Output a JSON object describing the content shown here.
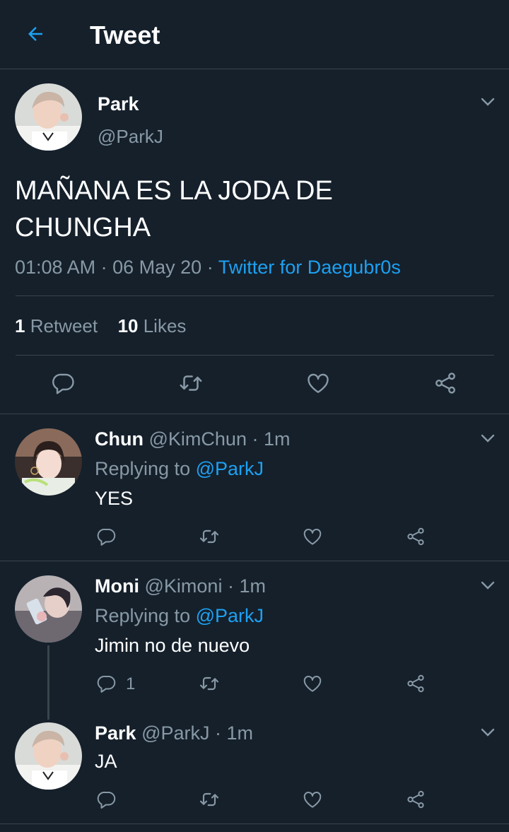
{
  "header": {
    "title": "Tweet"
  },
  "main_tweet": {
    "display_name": "Park",
    "handle": "@ParkJ",
    "text_line1": "MAÑANA ES LA JODA DE",
    "text_line2": "CHUNGHA",
    "time": "01:08 AM",
    "date": "06 May 20",
    "separator": "·",
    "source": "Twitter for Daegubr0s",
    "retweets_count": "1",
    "retweets_label": "Retweet",
    "likes_count": "10",
    "likes_label": "Likes"
  },
  "replies": [
    {
      "display_name": "Chun",
      "handle": "@KimChun",
      "time": "· 1m",
      "replying_label": "Replying to",
      "replying_handle": "@ParkJ",
      "text": "YES",
      "reply_count": ""
    },
    {
      "display_name": "Moni",
      "handle": "@Kimoni",
      "time": "· 1m",
      "replying_label": "Replying to",
      "replying_handle": "@ParkJ",
      "text": "Jimin no de nuevo",
      "reply_count": "1"
    },
    {
      "display_name": "Park",
      "handle": "@ParkJ",
      "time": "· 1m",
      "text": "JA"
    }
  ],
  "colors": {
    "background": "#15202b",
    "accent": "#1da1f2",
    "muted": "#8899a6",
    "border": "#38444d"
  }
}
